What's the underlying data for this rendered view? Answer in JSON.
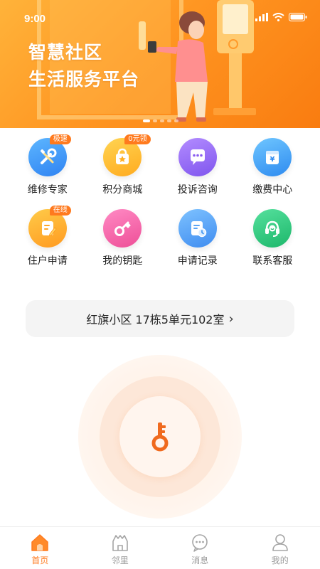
{
  "status_bar": {
    "time": "9:00"
  },
  "banner": {
    "title_line1": "智慧社区",
    "title_line2": "生活服务平台",
    "slide_count": 5,
    "active_slide": 1
  },
  "services": [
    {
      "label": "维修专家",
      "badge": "极速",
      "icon": "tools-icon"
    },
    {
      "label": "积分商城",
      "badge": "0元领",
      "icon": "shopping-bag-icon"
    },
    {
      "label": "投诉咨询",
      "badge": "",
      "icon": "chat-bubble-icon"
    },
    {
      "label": "缴费中心",
      "badge": "",
      "icon": "wallet-icon"
    },
    {
      "label": "住户申请",
      "badge": "在线",
      "icon": "edit-form-icon"
    },
    {
      "label": "我的钥匙",
      "badge": "",
      "icon": "key-icon"
    },
    {
      "label": "申请记录",
      "badge": "",
      "icon": "record-icon"
    },
    {
      "label": "联系客服",
      "badge": "",
      "icon": "headset-icon"
    }
  ],
  "address": {
    "text": "红旗小区 17栋5单元102室",
    "chevron": "›"
  },
  "unlock": {
    "icon": "key-icon"
  },
  "tabs": [
    {
      "label": "首页",
      "icon": "home-icon",
      "active": true
    },
    {
      "label": "邻里",
      "icon": "neighbors-icon",
      "active": false
    },
    {
      "label": "消息",
      "icon": "message-icon",
      "active": false
    },
    {
      "label": "我的",
      "icon": "profile-icon",
      "active": false
    }
  ],
  "colors": {
    "accent": "#ff7a1e",
    "banner_start": "#ffb33a",
    "banner_end": "#f97c10"
  }
}
